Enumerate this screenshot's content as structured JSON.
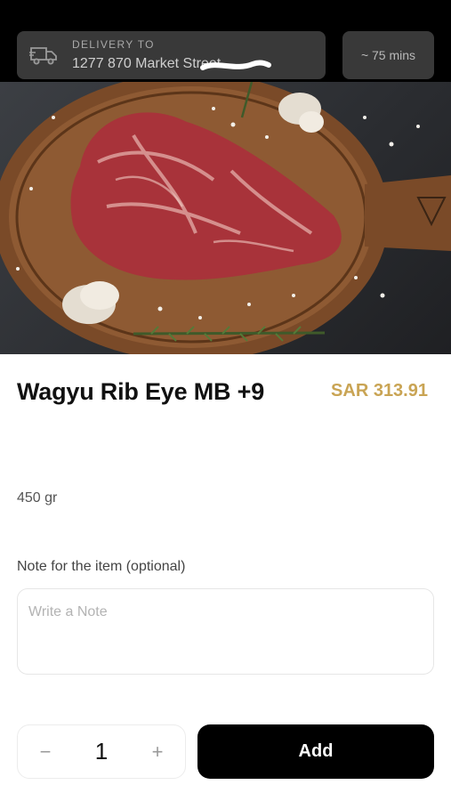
{
  "header": {
    "delivery_label": "DELIVERY TO",
    "delivery_address": "1277 870 Market Street",
    "eta": "~ 75 mins"
  },
  "product": {
    "name": "Wagyu Rib Eye MB +9",
    "price": "SAR 313.91",
    "weight": "450 gr",
    "image_icon": "product-photo"
  },
  "note": {
    "label": "Note for the item (optional)",
    "placeholder": "Write a Note",
    "value": ""
  },
  "cart": {
    "minus_label": "−",
    "quantity": "1",
    "plus_label": "+",
    "add_label": "Add"
  },
  "colors": {
    "accent_price": "#c9a454",
    "primary_button": "#000000"
  }
}
